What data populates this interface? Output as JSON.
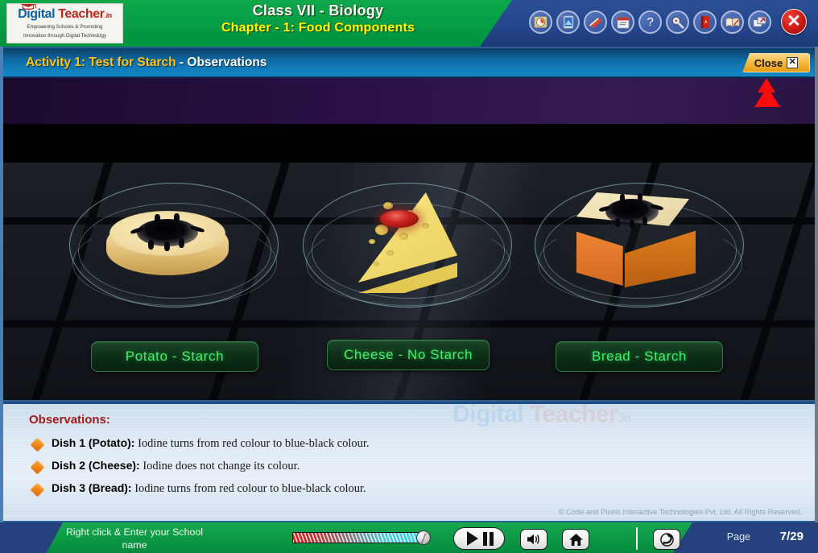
{
  "header": {
    "logo": {
      "brand_part1": "D",
      "brand_part2": "igital",
      "brand_part3": " Teacher",
      "brand_tld": ".in",
      "tagline_line1": "Empowering Schools & Promoting",
      "tagline_line2": "Innovation through Digital Technology"
    },
    "title_line1": "Class VII - Biology",
    "title_line2": "Chapter - 1: Food Components",
    "icons": [
      {
        "name": "timer-icon",
        "glyph": "◔"
      },
      {
        "name": "tablet-icon",
        "glyph": "▯"
      },
      {
        "name": "notebook-icon",
        "glyph": "▰"
      },
      {
        "name": "calendar-icon",
        "glyph": "☷"
      },
      {
        "name": "help-icon",
        "glyph": "?"
      },
      {
        "name": "magnifier-icon",
        "glyph": "⚲"
      },
      {
        "name": "dictionary-icon",
        "glyph": "▮"
      },
      {
        "name": "open-book-icon",
        "glyph": "◧"
      },
      {
        "name": "export-window-icon",
        "glyph": "❐"
      }
    ],
    "close_window_glyph": "✕"
  },
  "activity": {
    "title_highlight": "Activity 1: Test for Starch",
    "title_rest": " - Observations",
    "close_label": "Close",
    "close_icon_glyph": "✕"
  },
  "stage": {
    "dishes": [
      {
        "id": "potato",
        "label": "Potato - Starch",
        "result": "starch"
      },
      {
        "id": "cheese",
        "label": "Cheese - No Starch",
        "result": "no-starch"
      },
      {
        "id": "bread",
        "label": "Bread - Starch",
        "result": "starch"
      }
    ]
  },
  "observations": {
    "heading": "Observations:",
    "watermark_part1": "Digital",
    "watermark_part2": " Teacher",
    "watermark_tld": ".in",
    "items": [
      {
        "label": "Dish 1 (Potato):",
        "text": " Iodine turns from red colour to blue-black colour."
      },
      {
        "label": "Dish 2 (Cheese):",
        "text": " Iodine does not change its colour."
      },
      {
        "label": "Dish 3 (Bread):",
        "text": " Iodine turns from red colour to blue-black colour."
      }
    ],
    "copyright": "© Code and Pixels Interactive Technologies  Pvt. Ltd. All Rights Reserved."
  },
  "footer": {
    "school_note_line1": "Right click & Enter your School",
    "school_note_line2": "name",
    "page_label": "Page",
    "page_value": "7/29",
    "volume_glyph": "◀",
    "home_glyph": "⌂",
    "replay_glyph": "↻"
  },
  "colors": {
    "header_green": "#06a047",
    "header_blue": "#24458a",
    "activity_blue": "#0f6ea8",
    "gold": "#ffc215",
    "label_green": "#3ff06a",
    "obs_heading_red": "#9e1b18",
    "bullet_orange": "#f08a1c",
    "close_red": "#cc1a14"
  }
}
